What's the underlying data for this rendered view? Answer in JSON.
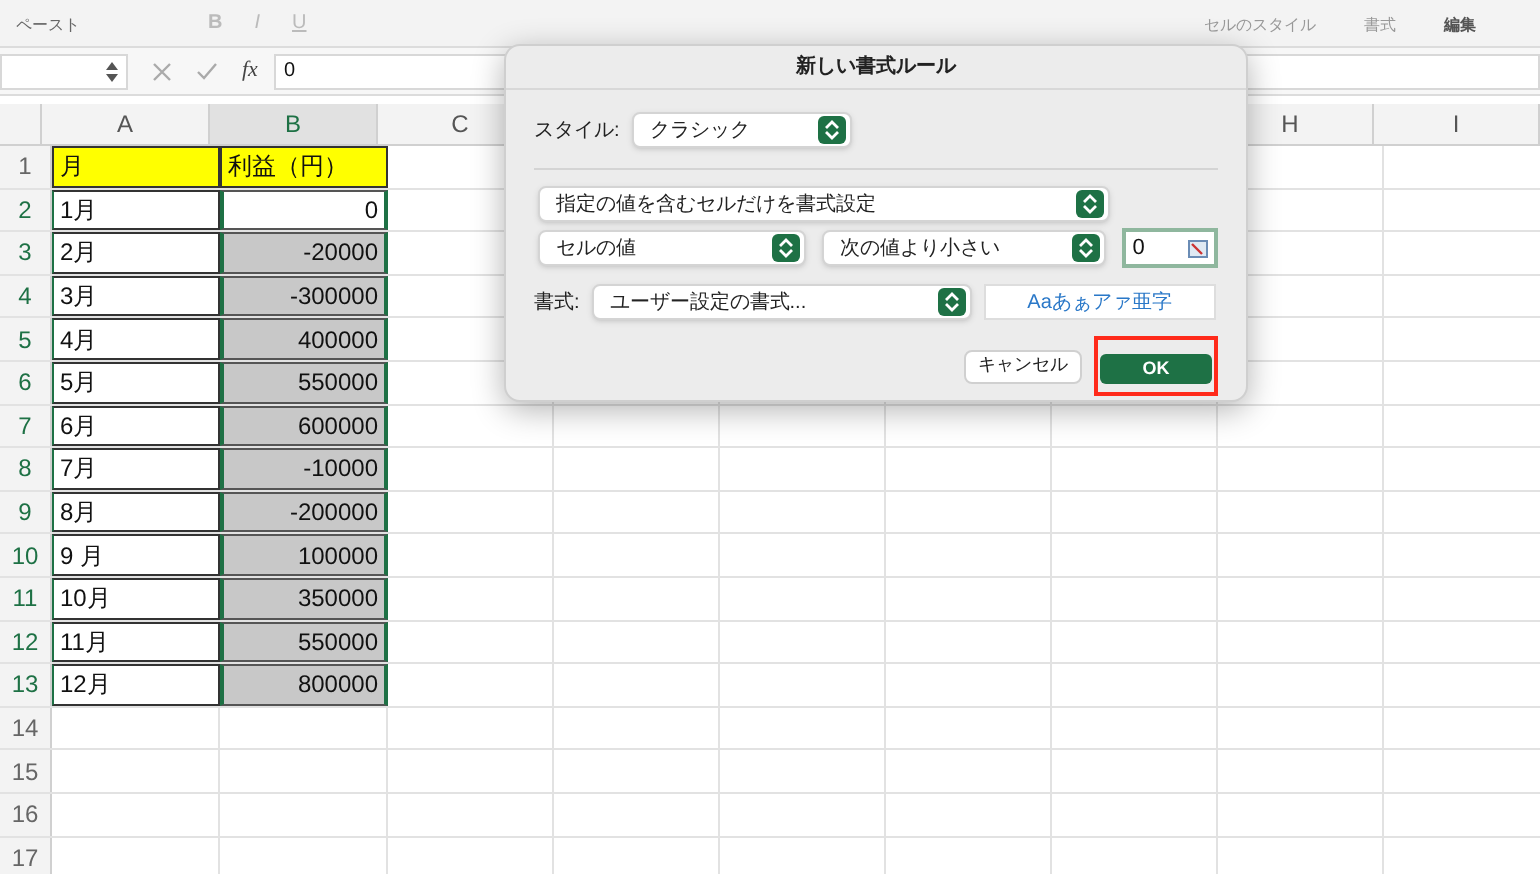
{
  "ribbon": {
    "paste": "ペースト",
    "bold": "B",
    "italic": "I",
    "underline": "U",
    "cell_style": "セルのスタイル",
    "format": "書式",
    "edit": "編集"
  },
  "formula_bar": {
    "fx": "fx",
    "value": "0"
  },
  "columns": [
    {
      "label": "A",
      "selected": false
    },
    {
      "label": "B",
      "selected": true
    },
    {
      "label": "C",
      "selected": false
    }
  ],
  "columns_right": [
    {
      "label": "H",
      "selected": false
    },
    {
      "label": "I",
      "selected": false
    }
  ],
  "rows": [
    {
      "number": "1",
      "selected": false,
      "kind": "header",
      "cells": [
        {
          "text": "月"
        },
        {
          "text": "利益（円）"
        }
      ]
    },
    {
      "number": "2",
      "selected": true,
      "kind": "data",
      "cells": [
        {
          "text": "1月"
        },
        {
          "text": "0",
          "shaded": false
        }
      ]
    },
    {
      "number": "3",
      "selected": true,
      "kind": "data",
      "cells": [
        {
          "text": "2月"
        },
        {
          "text": "-20000",
          "shaded": true
        }
      ]
    },
    {
      "number": "4",
      "selected": true,
      "kind": "data",
      "cells": [
        {
          "text": "3月"
        },
        {
          "text": "-300000",
          "shaded": true
        }
      ]
    },
    {
      "number": "5",
      "selected": true,
      "kind": "data",
      "cells": [
        {
          "text": "4月"
        },
        {
          "text": "400000",
          "shaded": true
        }
      ]
    },
    {
      "number": "6",
      "selected": true,
      "kind": "data",
      "cells": [
        {
          "text": "5月"
        },
        {
          "text": "550000",
          "shaded": true
        }
      ]
    },
    {
      "number": "7",
      "selected": true,
      "kind": "data",
      "cells": [
        {
          "text": "6月"
        },
        {
          "text": "600000",
          "shaded": true
        }
      ]
    },
    {
      "number": "8",
      "selected": true,
      "kind": "data",
      "cells": [
        {
          "text": "7月"
        },
        {
          "text": "-10000",
          "shaded": true
        }
      ]
    },
    {
      "number": "9",
      "selected": true,
      "kind": "data",
      "cells": [
        {
          "text": "8月"
        },
        {
          "text": "-200000",
          "shaded": true
        }
      ]
    },
    {
      "number": "10",
      "selected": true,
      "kind": "data",
      "cells": [
        {
          "text": "9 月"
        },
        {
          "text": "100000",
          "shaded": true
        }
      ]
    },
    {
      "number": "11",
      "selected": true,
      "kind": "data",
      "cells": [
        {
          "text": "10月"
        },
        {
          "text": "350000",
          "shaded": true
        }
      ]
    },
    {
      "number": "12",
      "selected": true,
      "kind": "data",
      "cells": [
        {
          "text": "11月"
        },
        {
          "text": "550000",
          "shaded": true
        }
      ]
    },
    {
      "number": "13",
      "selected": true,
      "kind": "data",
      "cells": [
        {
          "text": "12月"
        },
        {
          "text": "800000",
          "shaded": true
        }
      ]
    },
    {
      "number": "14",
      "selected": false,
      "kind": "empty"
    },
    {
      "number": "15",
      "selected": false,
      "kind": "empty"
    },
    {
      "number": "16",
      "selected": false,
      "kind": "empty"
    },
    {
      "number": "17",
      "selected": false,
      "kind": "empty"
    }
  ],
  "dialog": {
    "title": "新しい書式ルール",
    "style_label": "スタイル:",
    "style": "クラシック",
    "rule_type": "指定の値を含むセルだけを書式設定",
    "condition_subject": "セルの値",
    "condition_operator": "次の値より小さい",
    "condition_value": "0",
    "format_label": "書式:",
    "format": "ユーザー設定の書式...",
    "preview": "Aaあぁアァ亜字",
    "cancel": "キャンセル",
    "ok": "OK"
  }
}
